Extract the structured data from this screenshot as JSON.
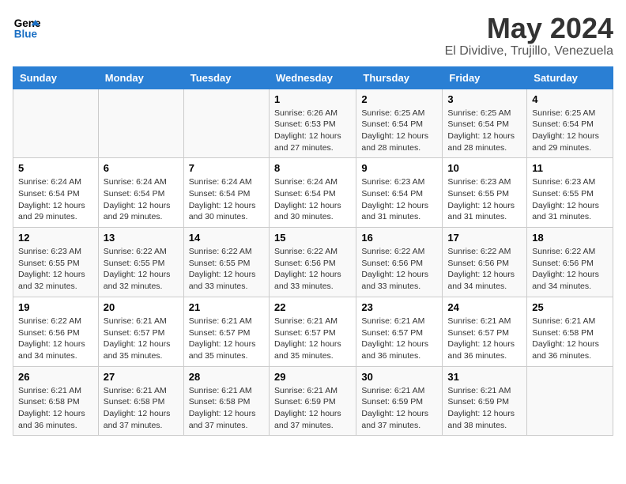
{
  "logo": {
    "line1": "General",
    "line2": "Blue"
  },
  "header": {
    "title": "May 2024",
    "subtitle": "El Dividive, Trujillo, Venezuela"
  },
  "days_of_week": [
    "Sunday",
    "Monday",
    "Tuesday",
    "Wednesday",
    "Thursday",
    "Friday",
    "Saturday"
  ],
  "weeks": [
    [
      {
        "day": "",
        "info": ""
      },
      {
        "day": "",
        "info": ""
      },
      {
        "day": "",
        "info": ""
      },
      {
        "day": "1",
        "info": "Sunrise: 6:26 AM\nSunset: 6:53 PM\nDaylight: 12 hours and 27 minutes."
      },
      {
        "day": "2",
        "info": "Sunrise: 6:25 AM\nSunset: 6:54 PM\nDaylight: 12 hours and 28 minutes."
      },
      {
        "day": "3",
        "info": "Sunrise: 6:25 AM\nSunset: 6:54 PM\nDaylight: 12 hours and 28 minutes."
      },
      {
        "day": "4",
        "info": "Sunrise: 6:25 AM\nSunset: 6:54 PM\nDaylight: 12 hours and 29 minutes."
      }
    ],
    [
      {
        "day": "5",
        "info": "Sunrise: 6:24 AM\nSunset: 6:54 PM\nDaylight: 12 hours and 29 minutes."
      },
      {
        "day": "6",
        "info": "Sunrise: 6:24 AM\nSunset: 6:54 PM\nDaylight: 12 hours and 29 minutes."
      },
      {
        "day": "7",
        "info": "Sunrise: 6:24 AM\nSunset: 6:54 PM\nDaylight: 12 hours and 30 minutes."
      },
      {
        "day": "8",
        "info": "Sunrise: 6:24 AM\nSunset: 6:54 PM\nDaylight: 12 hours and 30 minutes."
      },
      {
        "day": "9",
        "info": "Sunrise: 6:23 AM\nSunset: 6:54 PM\nDaylight: 12 hours and 31 minutes."
      },
      {
        "day": "10",
        "info": "Sunrise: 6:23 AM\nSunset: 6:55 PM\nDaylight: 12 hours and 31 minutes."
      },
      {
        "day": "11",
        "info": "Sunrise: 6:23 AM\nSunset: 6:55 PM\nDaylight: 12 hours and 31 minutes."
      }
    ],
    [
      {
        "day": "12",
        "info": "Sunrise: 6:23 AM\nSunset: 6:55 PM\nDaylight: 12 hours and 32 minutes."
      },
      {
        "day": "13",
        "info": "Sunrise: 6:22 AM\nSunset: 6:55 PM\nDaylight: 12 hours and 32 minutes."
      },
      {
        "day": "14",
        "info": "Sunrise: 6:22 AM\nSunset: 6:55 PM\nDaylight: 12 hours and 33 minutes."
      },
      {
        "day": "15",
        "info": "Sunrise: 6:22 AM\nSunset: 6:56 PM\nDaylight: 12 hours and 33 minutes."
      },
      {
        "day": "16",
        "info": "Sunrise: 6:22 AM\nSunset: 6:56 PM\nDaylight: 12 hours and 33 minutes."
      },
      {
        "day": "17",
        "info": "Sunrise: 6:22 AM\nSunset: 6:56 PM\nDaylight: 12 hours and 34 minutes."
      },
      {
        "day": "18",
        "info": "Sunrise: 6:22 AM\nSunset: 6:56 PM\nDaylight: 12 hours and 34 minutes."
      }
    ],
    [
      {
        "day": "19",
        "info": "Sunrise: 6:22 AM\nSunset: 6:56 PM\nDaylight: 12 hours and 34 minutes."
      },
      {
        "day": "20",
        "info": "Sunrise: 6:21 AM\nSunset: 6:57 PM\nDaylight: 12 hours and 35 minutes."
      },
      {
        "day": "21",
        "info": "Sunrise: 6:21 AM\nSunset: 6:57 PM\nDaylight: 12 hours and 35 minutes."
      },
      {
        "day": "22",
        "info": "Sunrise: 6:21 AM\nSunset: 6:57 PM\nDaylight: 12 hours and 35 minutes."
      },
      {
        "day": "23",
        "info": "Sunrise: 6:21 AM\nSunset: 6:57 PM\nDaylight: 12 hours and 36 minutes."
      },
      {
        "day": "24",
        "info": "Sunrise: 6:21 AM\nSunset: 6:57 PM\nDaylight: 12 hours and 36 minutes."
      },
      {
        "day": "25",
        "info": "Sunrise: 6:21 AM\nSunset: 6:58 PM\nDaylight: 12 hours and 36 minutes."
      }
    ],
    [
      {
        "day": "26",
        "info": "Sunrise: 6:21 AM\nSunset: 6:58 PM\nDaylight: 12 hours and 36 minutes."
      },
      {
        "day": "27",
        "info": "Sunrise: 6:21 AM\nSunset: 6:58 PM\nDaylight: 12 hours and 37 minutes."
      },
      {
        "day": "28",
        "info": "Sunrise: 6:21 AM\nSunset: 6:58 PM\nDaylight: 12 hours and 37 minutes."
      },
      {
        "day": "29",
        "info": "Sunrise: 6:21 AM\nSunset: 6:59 PM\nDaylight: 12 hours and 37 minutes."
      },
      {
        "day": "30",
        "info": "Sunrise: 6:21 AM\nSunset: 6:59 PM\nDaylight: 12 hours and 37 minutes."
      },
      {
        "day": "31",
        "info": "Sunrise: 6:21 AM\nSunset: 6:59 PM\nDaylight: 12 hours and 38 minutes."
      },
      {
        "day": "",
        "info": ""
      }
    ]
  ]
}
